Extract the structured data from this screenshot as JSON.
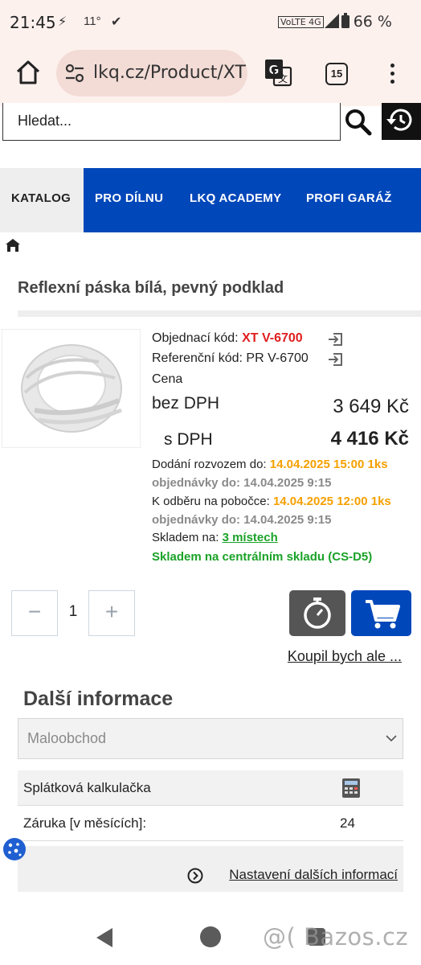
{
  "status_bar": {
    "time": "21:45",
    "temperature": "11°",
    "network": "VoLTE 4G",
    "battery": "66 %"
  },
  "browser": {
    "url": "lkq.cz/Product/XT",
    "tab_count": "15"
  },
  "search": {
    "placeholder": "Hledat..."
  },
  "nav": {
    "items": [
      {
        "label": "KATALOG"
      },
      {
        "label": "PRO DÍLNU"
      },
      {
        "label": "LKQ ACADEMY"
      },
      {
        "label": "PROFI GARÁŽ"
      }
    ]
  },
  "product": {
    "title": "Reflexní páska bílá, pevný podklad",
    "order_code_label": "Objednací kód:",
    "order_code": "XT V-6700",
    "reference_code_label": "Referenční kód:",
    "reference_code": "PR V-6700",
    "price_label": "Cena",
    "price_excl_label": "bez DPH",
    "price_excl": "3 649 Kč",
    "price_incl_label": "s DPH",
    "price_incl": "4 416 Kč",
    "delivery_label": "Dodání rozvozem do:",
    "delivery_value": "14.04.2025 15:00 1ks",
    "delivery_order": "objednávky do: 14.04.2025 9:15",
    "pickup_label": "K odběru na pobočce:",
    "pickup_value": "14.04.2025 12:00 1ks",
    "pickup_order": "objednávky do: 14.04.2025 9:15",
    "stock_label": "Skladem na:",
    "stock_link": "3 místech",
    "central_stock": "Skladem na centrálním skladu (CS-D5)"
  },
  "cart": {
    "minus": "−",
    "quantity": "1",
    "plus": "+",
    "buy_later_link": "Koupil bych ale ..."
  },
  "more_info": {
    "title": "Další informace",
    "select_value": "Maloobchod",
    "rows": [
      {
        "label": "Splátková kalkulačka",
        "value": ""
      },
      {
        "label": "Záruka [v měsících]:",
        "value": "24"
      }
    ],
    "settings_link": "Nastavení dalších informací"
  },
  "watermark": "@( Bazos.cz",
  "colors": {
    "brand_blue": "#0047ba",
    "code_red": "#e01e1e",
    "date_orange": "#f5a000",
    "stock_green": "#1aa228"
  }
}
